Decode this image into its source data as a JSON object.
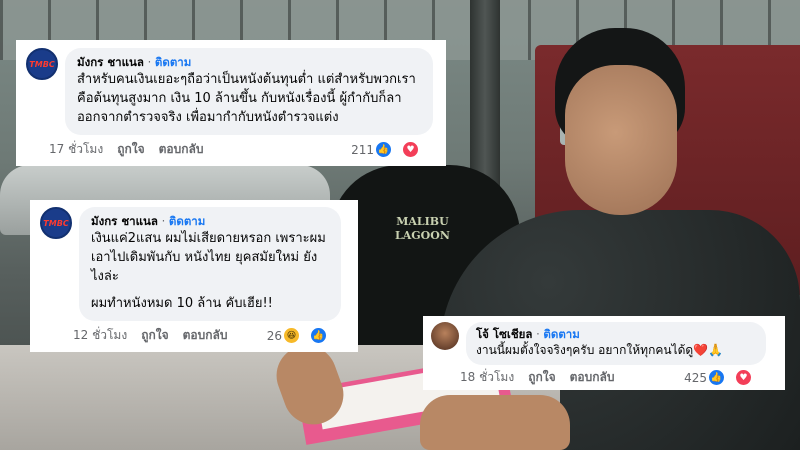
{
  "comments": [
    {
      "author": "มังกร ชาแนล",
      "follow": "ติดตาม",
      "avatar": "channel-logo",
      "avatar_text": "TMBC",
      "paragraphs": [
        "สำหรับคนเงินเยอะๆถือว่าเป็นหนังต้นทุนต่ำ แต่สำหรับพวกเราคือต้นทุนสูงมาก เงิน 10 ล้านขึ้น กับหนังเรื่องนี้ ผู้กำกับก็ลาออกจากตำรวจจริง เพื่อมากำกับหนังตำรวจแต่ง"
      ],
      "time": "17 ชั่วโมง",
      "like": "ถูกใจ",
      "reply": "ตอบกลับ",
      "reaction_count": "211",
      "reactions": [
        "like-icon",
        "love-icon"
      ]
    },
    {
      "author": "มังกร ชาแนล",
      "follow": "ติดตาม",
      "avatar": "channel-logo",
      "avatar_text": "TMBC",
      "paragraphs": [
        "เงินแค่2แสน ผมไม่เสียดายหรอก เพราะผมเอาไปเดิมพันกับ หนังไทย ยุคสมัยใหม่ ยังไงล่ะ",
        "ผมทำหนังหมด 10 ล้าน คับเฮีย!!"
      ],
      "time": "12 ชั่วโมง",
      "like": "ถูกใจ",
      "reply": "ตอบกลับ",
      "reaction_count": "26",
      "reactions": [
        "haha-icon",
        "like-icon"
      ]
    },
    {
      "author": "โจ้ โซเชียล",
      "follow": "ติดตาม",
      "avatar": "profile-photo",
      "avatar_text": "",
      "paragraphs": [
        "งานนี้ผมตั้งใจจริงๆครับ อยากให้ทุกคนได้ดู❤️🙏"
      ],
      "time": "18 ชั่วโมง",
      "like": "ถูกใจ",
      "reply": "ตอบกลับ",
      "reaction_count": "425",
      "reactions": [
        "like-icon",
        "love-icon"
      ]
    }
  ],
  "photo": {
    "shirt_text_line1": "MALIBU",
    "shirt_text_line2": "LAGOON"
  },
  "colors": {
    "bubble": "#f0f2f5",
    "follow": "#1877f2",
    "like": "#1877f2",
    "love": "#f33e58",
    "haha": "#f7b928"
  }
}
